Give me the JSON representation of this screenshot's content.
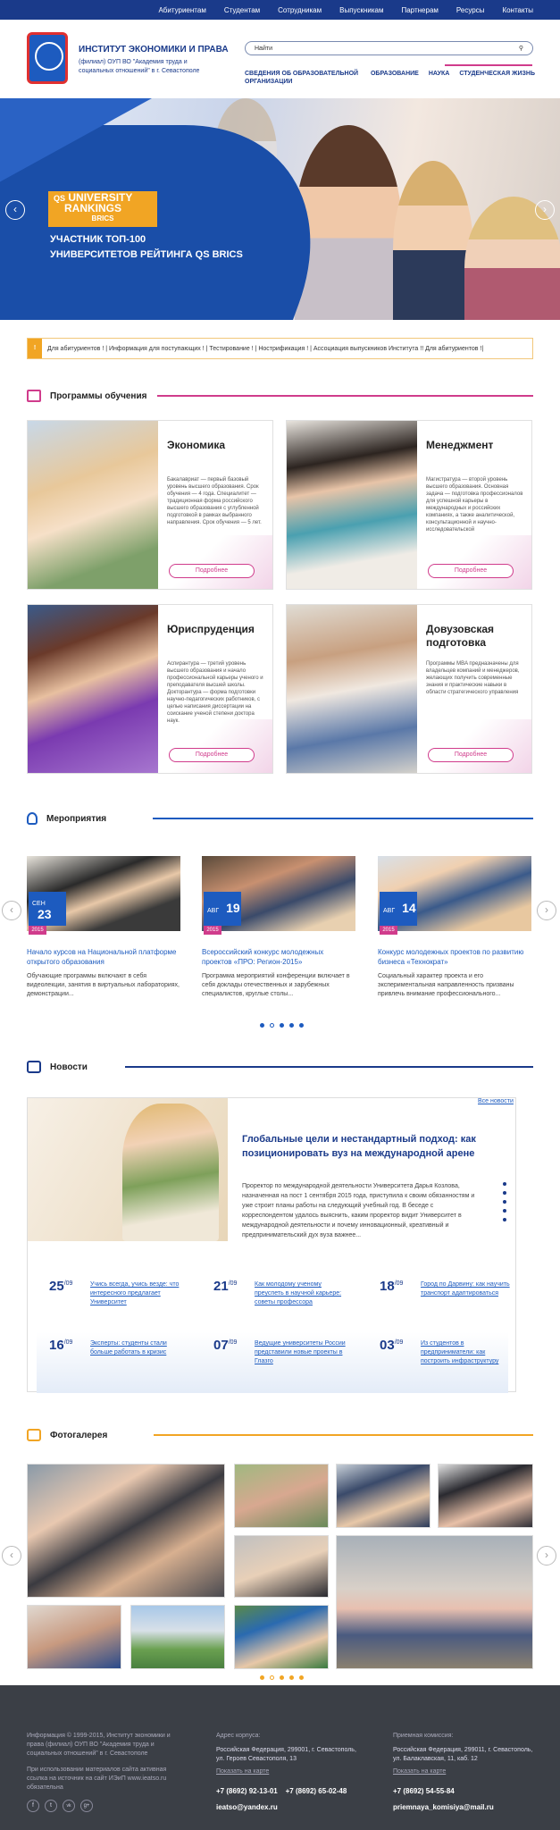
{
  "topnav": [
    "Абитуриентам",
    "Студентам",
    "Сотрудникам",
    "Выпускникам",
    "Партнерам",
    "Ресурсы",
    "Контакты"
  ],
  "brand": {
    "title": "ИНСТИТУТ ЭКОНОМИКИ И ПРАВА",
    "subtitle": "(филиал) ОУП ВО \"Академия труда и социальных отношений\" в г. Севастополе"
  },
  "search": {
    "placeholder": "Найти"
  },
  "mainnav": [
    "СВЕДЕНИЯ ОБ ОБРАЗОВАТЕЛЬНОЙ ОРГАНИЗАЦИИ",
    "ОБРАЗОВАНИЕ",
    "НАУКА",
    "СТУДЕНЧЕСКАЯ ЖИЗНЬ"
  ],
  "hero": {
    "qs_line1": "UNIVERSITY",
    "qs_line2": "RANKINGS",
    "qs_line3": "BRICS",
    "qs_mark": "QS",
    "text_line1": "УЧАСТНИК ТОП-100",
    "text_line2": "УНИВЕРСИТЕТОВ РЕЙТИНГА QS BRICS"
  },
  "ticker": {
    "mark": "!",
    "text": "Для абитуриентов ! | Информация для поступающих ! | Тестирование ! | Нострификация ! | Ассоциация выпускников Института !! Для абитуриентов !|"
  },
  "sections": {
    "programs": "Программы обучения",
    "events": "Мероприятия",
    "news": "Новости",
    "gallery": "Фотогалерея"
  },
  "programs": [
    {
      "title": "Экономика",
      "desc": "Бакалавриат — первый базовый уровень высшего образования. Срок обучения — 4 года. Специалитет — традиционная форма российского высшего образования с углубленной подготовкой в рамках выбранного направления. Срок обучения — 5 лет.",
      "button": "Подробнее"
    },
    {
      "title": "Менеджмент",
      "desc": "Магистратура — второй уровень высшего образования. Основная задача — подготовка профессионалов для успешной карьеры в международных и российских компаниях, а также аналитической, консультационной и научно-исследовательской",
      "button": "Подробнее"
    },
    {
      "title": "Юриспруденция",
      "desc": "Аспирантура — третий уровень высшего образования и начало профессиональной карьеры ученого и преподавателя высшей школы. Докторантура — форма подготовки научно-педагогических работников, с целью написания диссертации на соискание ученой степени доктора наук.",
      "button": "Подробнее"
    },
    {
      "title": "Довузовская подготовка",
      "desc": "Программы MBA предназначены для владельцев компаний и менеджеров, желающих получить современные знания и практические навыки в области стратегического управления",
      "button": "Подробнее"
    }
  ],
  "events": [
    {
      "month": "СЕН",
      "day": "23",
      "year": "2015",
      "title": "Начало курсов на Национальной платформе открытого образования",
      "desc": "Обучающие программы включают в себя видеолекции, занятия в виртуальных лабораториях, демонстрации..."
    },
    {
      "month": "АВГ",
      "day": "19",
      "year": "2015",
      "title": "Всероссийский конкурс молодежных проектов «ПРО: Регион-2015»",
      "desc": "Программа мероприятий конференции включает в себя доклады отечественных и зарубежных специалистов, круглые столы..."
    },
    {
      "month": "АВГ",
      "day": "14",
      "year": "2015",
      "title": "Конкурс молодежных проектов по развитию бизнеса «Технократ»",
      "desc": "Социальный характер проекта и его экспериментальная направленность призваны привлечь внимание профессионального..."
    }
  ],
  "news": {
    "all_link": "Все новости",
    "title": "Глобальные цели и нестандартный подход: как позиционировать вуз на международной арене",
    "text": "Проректор по международной деятельности Университета Дарья Козлова, назначенная на пост 1 сентября 2015 года, приступила к своим обязанностям и уже строит планы работы на следующий учебный год. В беседе с корреспондентом удалось выяснить, каким проректор видит Университет в международной деятельности и почему инновационный, креативный и предпринимательский дух вуза важнее...",
    "items": [
      {
        "day": "25",
        "month": "/09",
        "title": "Учись всегда, учись везде: что интересного предлагает Университет"
      },
      {
        "day": "21",
        "month": "/09",
        "title": "Как молодому ученому преуспеть в научной карьере: советы профессора"
      },
      {
        "day": "18",
        "month": "/09",
        "title": "Город по Дарвину: как научить транспорт адаптироваться"
      },
      {
        "day": "16",
        "month": "/09",
        "title": "Эксперты: студенты стали больше работать в кризис"
      },
      {
        "day": "07",
        "month": "/09",
        "title": "Ведущие университеты России представили новые проекты в Глазго"
      },
      {
        "day": "03",
        "month": "/09",
        "title": "Из студентов в предприниматели: как построить инфраструктуру"
      }
    ]
  },
  "footer": {
    "info": "Информация © 1999-2015, Институт экономики и права (филиал) ОУП ВО \"Академия труда и социальных отношений\" в г. Севастополе",
    "info2": "При использовании материалов сайта активная ссылка на источник на сайт ИЭиП www.ieatso.ru обязательна",
    "addr_label": "Адрес корпуса:",
    "addr": "Российская Федерация, 299001, г. Севастополь, ул. Героев Севастополя, 13",
    "map_link": "Показать на карте",
    "phones": "+7 (8692) 92-13-01    +7 (8692) 65-02-48",
    "email": "ieatso@yandex.ru",
    "adm_label": "Приемная комиссия:",
    "adm_addr": "Российская Федерация, 299011, г. Севастополь, ул. Балаклавская, 11, каб. 12",
    "adm_map": "Показать на карте",
    "adm_phone": "+7 (8692) 54-55-84",
    "adm_email": "priemnaya_komisiya@mail.ru",
    "social": [
      "f",
      "t",
      "vk",
      "g+"
    ]
  },
  "colors": {
    "navy": "#1a3a8a",
    "blue": "#1d5bbf",
    "pink": "#d03c8c",
    "orange": "#f1a524"
  }
}
